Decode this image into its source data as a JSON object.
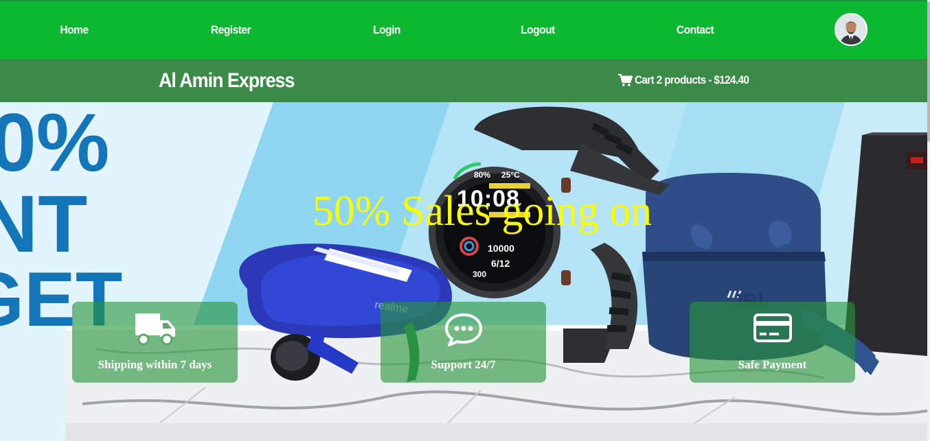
{
  "nav": {
    "items": [
      {
        "label": "Home"
      },
      {
        "label": "Register"
      },
      {
        "label": "Login"
      },
      {
        "label": "Logout"
      },
      {
        "label": "Contact"
      }
    ],
    "avatar_icon": "user-avatar-photo"
  },
  "brand": {
    "name": "Al Amin Express"
  },
  "cart": {
    "icon": "cart-icon",
    "label": "Cart 2 products - $124.40"
  },
  "hero": {
    "headline": "50% Sales going on",
    "bg_text_lines": [
      "0%",
      "NT",
      "GET"
    ],
    "features": [
      {
        "icon": "truck-icon",
        "label": "Shipping within 7 days"
      },
      {
        "icon": "chat-icon",
        "label": "Support 24/7"
      },
      {
        "icon": "credit-card-icon",
        "label": "Safe Payment"
      }
    ]
  },
  "colors": {
    "nav_bg": "#0bb830",
    "brand_bg": "#3c8a48",
    "headline": "#fafc00",
    "feature_box": "rgba(40,150,60,0.62)"
  }
}
